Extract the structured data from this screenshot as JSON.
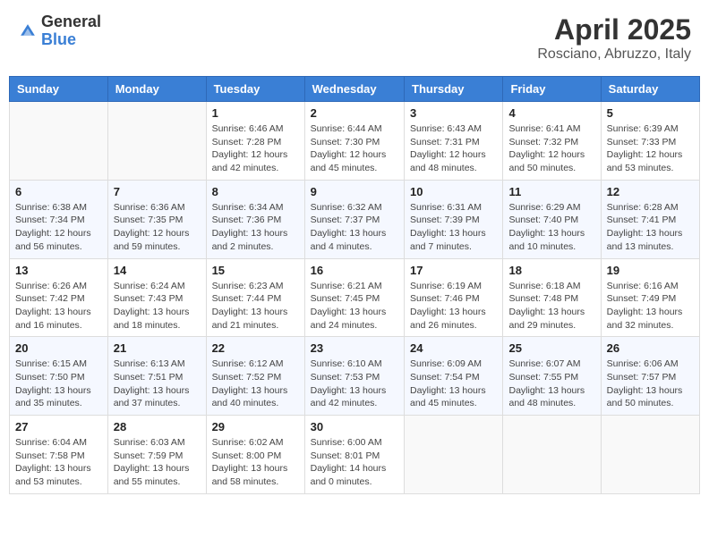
{
  "header": {
    "logo_general": "General",
    "logo_blue": "Blue",
    "month_title": "April 2025",
    "subtitle": "Rosciano, Abruzzo, Italy"
  },
  "days_of_week": [
    "Sunday",
    "Monday",
    "Tuesday",
    "Wednesday",
    "Thursday",
    "Friday",
    "Saturday"
  ],
  "weeks": [
    [
      {
        "day": "",
        "sunrise": "",
        "sunset": "",
        "daylight": ""
      },
      {
        "day": "",
        "sunrise": "",
        "sunset": "",
        "daylight": ""
      },
      {
        "day": "1",
        "sunrise": "Sunrise: 6:46 AM",
        "sunset": "Sunset: 7:28 PM",
        "daylight": "Daylight: 12 hours and 42 minutes."
      },
      {
        "day": "2",
        "sunrise": "Sunrise: 6:44 AM",
        "sunset": "Sunset: 7:30 PM",
        "daylight": "Daylight: 12 hours and 45 minutes."
      },
      {
        "day": "3",
        "sunrise": "Sunrise: 6:43 AM",
        "sunset": "Sunset: 7:31 PM",
        "daylight": "Daylight: 12 hours and 48 minutes."
      },
      {
        "day": "4",
        "sunrise": "Sunrise: 6:41 AM",
        "sunset": "Sunset: 7:32 PM",
        "daylight": "Daylight: 12 hours and 50 minutes."
      },
      {
        "day": "5",
        "sunrise": "Sunrise: 6:39 AM",
        "sunset": "Sunset: 7:33 PM",
        "daylight": "Daylight: 12 hours and 53 minutes."
      }
    ],
    [
      {
        "day": "6",
        "sunrise": "Sunrise: 6:38 AM",
        "sunset": "Sunset: 7:34 PM",
        "daylight": "Daylight: 12 hours and 56 minutes."
      },
      {
        "day": "7",
        "sunrise": "Sunrise: 6:36 AM",
        "sunset": "Sunset: 7:35 PM",
        "daylight": "Daylight: 12 hours and 59 minutes."
      },
      {
        "day": "8",
        "sunrise": "Sunrise: 6:34 AM",
        "sunset": "Sunset: 7:36 PM",
        "daylight": "Daylight: 13 hours and 2 minutes."
      },
      {
        "day": "9",
        "sunrise": "Sunrise: 6:32 AM",
        "sunset": "Sunset: 7:37 PM",
        "daylight": "Daylight: 13 hours and 4 minutes."
      },
      {
        "day": "10",
        "sunrise": "Sunrise: 6:31 AM",
        "sunset": "Sunset: 7:39 PM",
        "daylight": "Daylight: 13 hours and 7 minutes."
      },
      {
        "day": "11",
        "sunrise": "Sunrise: 6:29 AM",
        "sunset": "Sunset: 7:40 PM",
        "daylight": "Daylight: 13 hours and 10 minutes."
      },
      {
        "day": "12",
        "sunrise": "Sunrise: 6:28 AM",
        "sunset": "Sunset: 7:41 PM",
        "daylight": "Daylight: 13 hours and 13 minutes."
      }
    ],
    [
      {
        "day": "13",
        "sunrise": "Sunrise: 6:26 AM",
        "sunset": "Sunset: 7:42 PM",
        "daylight": "Daylight: 13 hours and 16 minutes."
      },
      {
        "day": "14",
        "sunrise": "Sunrise: 6:24 AM",
        "sunset": "Sunset: 7:43 PM",
        "daylight": "Daylight: 13 hours and 18 minutes."
      },
      {
        "day": "15",
        "sunrise": "Sunrise: 6:23 AM",
        "sunset": "Sunset: 7:44 PM",
        "daylight": "Daylight: 13 hours and 21 minutes."
      },
      {
        "day": "16",
        "sunrise": "Sunrise: 6:21 AM",
        "sunset": "Sunset: 7:45 PM",
        "daylight": "Daylight: 13 hours and 24 minutes."
      },
      {
        "day": "17",
        "sunrise": "Sunrise: 6:19 AM",
        "sunset": "Sunset: 7:46 PM",
        "daylight": "Daylight: 13 hours and 26 minutes."
      },
      {
        "day": "18",
        "sunrise": "Sunrise: 6:18 AM",
        "sunset": "Sunset: 7:48 PM",
        "daylight": "Daylight: 13 hours and 29 minutes."
      },
      {
        "day": "19",
        "sunrise": "Sunrise: 6:16 AM",
        "sunset": "Sunset: 7:49 PM",
        "daylight": "Daylight: 13 hours and 32 minutes."
      }
    ],
    [
      {
        "day": "20",
        "sunrise": "Sunrise: 6:15 AM",
        "sunset": "Sunset: 7:50 PM",
        "daylight": "Daylight: 13 hours and 35 minutes."
      },
      {
        "day": "21",
        "sunrise": "Sunrise: 6:13 AM",
        "sunset": "Sunset: 7:51 PM",
        "daylight": "Daylight: 13 hours and 37 minutes."
      },
      {
        "day": "22",
        "sunrise": "Sunrise: 6:12 AM",
        "sunset": "Sunset: 7:52 PM",
        "daylight": "Daylight: 13 hours and 40 minutes."
      },
      {
        "day": "23",
        "sunrise": "Sunrise: 6:10 AM",
        "sunset": "Sunset: 7:53 PM",
        "daylight": "Daylight: 13 hours and 42 minutes."
      },
      {
        "day": "24",
        "sunrise": "Sunrise: 6:09 AM",
        "sunset": "Sunset: 7:54 PM",
        "daylight": "Daylight: 13 hours and 45 minutes."
      },
      {
        "day": "25",
        "sunrise": "Sunrise: 6:07 AM",
        "sunset": "Sunset: 7:55 PM",
        "daylight": "Daylight: 13 hours and 48 minutes."
      },
      {
        "day": "26",
        "sunrise": "Sunrise: 6:06 AM",
        "sunset": "Sunset: 7:57 PM",
        "daylight": "Daylight: 13 hours and 50 minutes."
      }
    ],
    [
      {
        "day": "27",
        "sunrise": "Sunrise: 6:04 AM",
        "sunset": "Sunset: 7:58 PM",
        "daylight": "Daylight: 13 hours and 53 minutes."
      },
      {
        "day": "28",
        "sunrise": "Sunrise: 6:03 AM",
        "sunset": "Sunset: 7:59 PM",
        "daylight": "Daylight: 13 hours and 55 minutes."
      },
      {
        "day": "29",
        "sunrise": "Sunrise: 6:02 AM",
        "sunset": "Sunset: 8:00 PM",
        "daylight": "Daylight: 13 hours and 58 minutes."
      },
      {
        "day": "30",
        "sunrise": "Sunrise: 6:00 AM",
        "sunset": "Sunset: 8:01 PM",
        "daylight": "Daylight: 14 hours and 0 minutes."
      },
      {
        "day": "",
        "sunrise": "",
        "sunset": "",
        "daylight": ""
      },
      {
        "day": "",
        "sunrise": "",
        "sunset": "",
        "daylight": ""
      },
      {
        "day": "",
        "sunrise": "",
        "sunset": "",
        "daylight": ""
      }
    ]
  ]
}
